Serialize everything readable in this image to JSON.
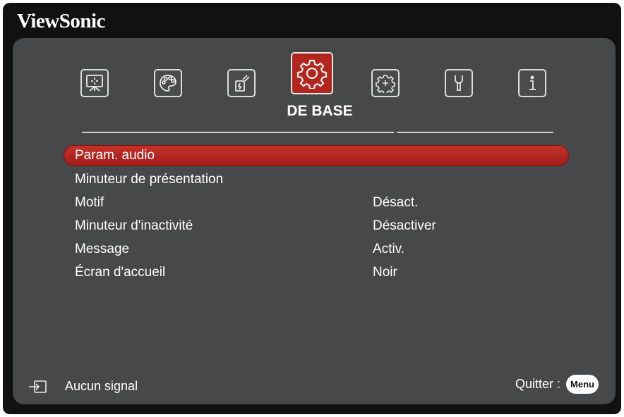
{
  "brand": "ViewSonic",
  "tabs": [
    {
      "icon": "display-icon",
      "active": false
    },
    {
      "icon": "palette-icon",
      "active": false
    },
    {
      "icon": "power-icon",
      "active": false
    },
    {
      "icon": "gear-icon",
      "active": true,
      "label": "DE BASE"
    },
    {
      "icon": "advanced-gear-icon",
      "active": false
    },
    {
      "icon": "wrench-icon",
      "active": false
    },
    {
      "icon": "info-icon",
      "active": false
    }
  ],
  "active_tab_label": "DE BASE",
  "menu": {
    "items": [
      {
        "label": "Param. audio",
        "value": "",
        "selected": true
      },
      {
        "label": "Minuteur de présentation",
        "value": ""
      },
      {
        "label": "Motif",
        "value": "Désact."
      },
      {
        "label": "Minuteur d'inactivité",
        "value": "Désactiver"
      },
      {
        "label": "Message",
        "value": "Activ."
      },
      {
        "label": "Écran d'accueil",
        "value": "Noir"
      }
    ]
  },
  "footer": {
    "signal_icon": "input-source-icon",
    "signal_text": "Aucun signal",
    "quit_label": "Quitter :",
    "menu_button": "Menu"
  },
  "colors": {
    "accent": "#b3261e",
    "panel": "#47484a",
    "frame": "#111111"
  }
}
